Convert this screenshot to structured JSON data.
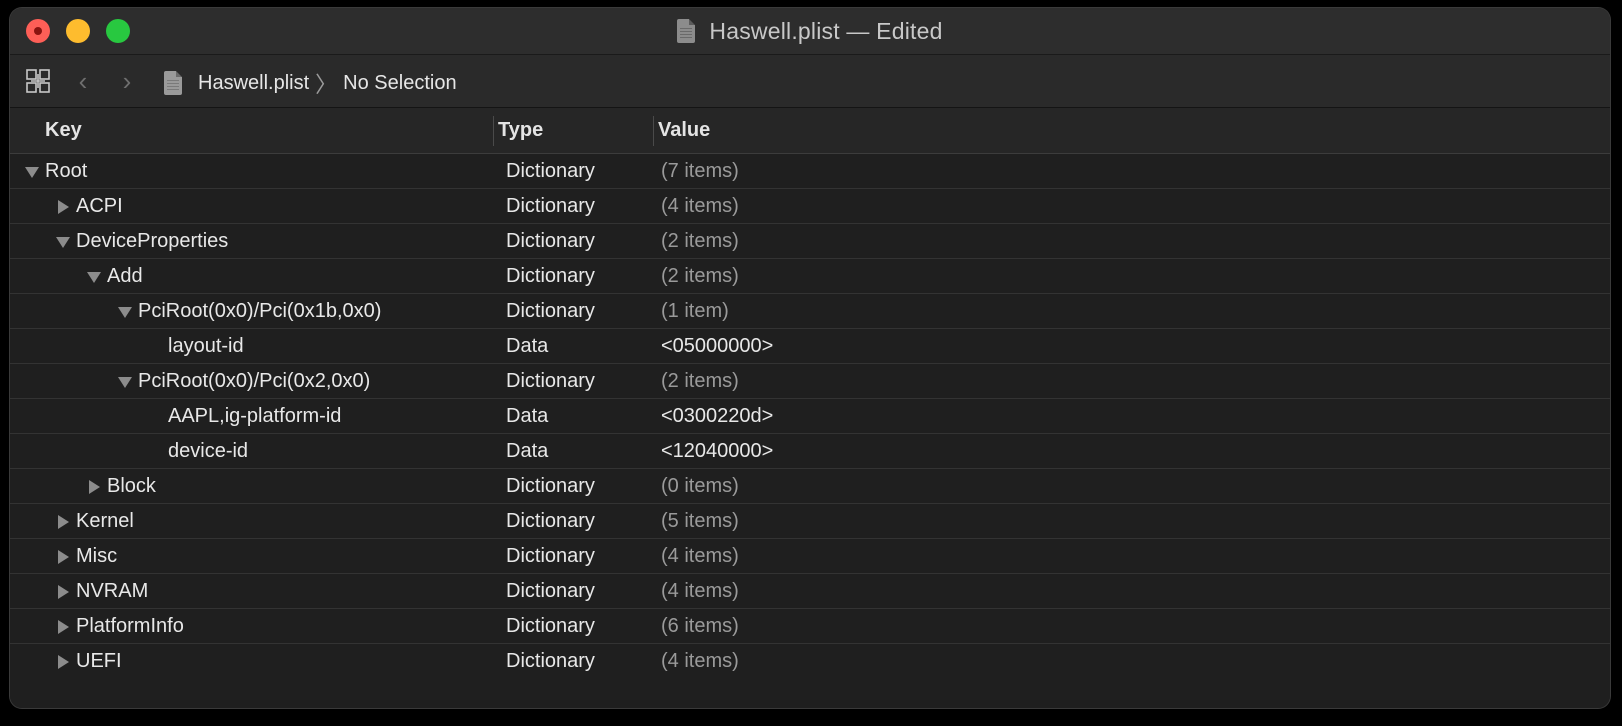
{
  "window": {
    "title": "Haswell.plist — Edited",
    "icon": "document-icon"
  },
  "toolbar": {
    "grid_icon": "grid-icon",
    "back_icon": "chevron-left-icon",
    "forward_icon": "chevron-right-icon",
    "back_glyph": "‹",
    "forward_glyph": "›",
    "breadcrumb": {
      "file": "Haswell.plist",
      "separator": "〉",
      "selection": "No Selection"
    }
  },
  "columns": {
    "key": "Key",
    "type": "Type",
    "value": "Value"
  },
  "rows": [
    {
      "key": "Root",
      "type": "Dictionary",
      "value": "(7 items)",
      "depth": 0,
      "disclosure": "open",
      "muted": true
    },
    {
      "key": "ACPI",
      "type": "Dictionary",
      "value": "(4 items)",
      "depth": 1,
      "disclosure": "closed",
      "muted": true
    },
    {
      "key": "DeviceProperties",
      "type": "Dictionary",
      "value": "(2 items)",
      "depth": 1,
      "disclosure": "open",
      "muted": true
    },
    {
      "key": "Add",
      "type": "Dictionary",
      "value": "(2 items)",
      "depth": 2,
      "disclosure": "open",
      "muted": true
    },
    {
      "key": "PciRoot(0x0)/Pci(0x1b,0x0)",
      "type": "Dictionary",
      "value": "(1 item)",
      "depth": 3,
      "disclosure": "open",
      "muted": true
    },
    {
      "key": "layout-id",
      "type": "Data",
      "value": "<05000000>",
      "depth": 4,
      "disclosure": "none",
      "muted": false
    },
    {
      "key": "PciRoot(0x0)/Pci(0x2,0x0)",
      "type": "Dictionary",
      "value": "(2 items)",
      "depth": 3,
      "disclosure": "open",
      "muted": true
    },
    {
      "key": "AAPL,ig-platform-id",
      "type": "Data",
      "value": "<0300220d>",
      "depth": 4,
      "disclosure": "none",
      "muted": false
    },
    {
      "key": "device-id",
      "type": "Data",
      "value": "<12040000>",
      "depth": 4,
      "disclosure": "none",
      "muted": false
    },
    {
      "key": "Block",
      "type": "Dictionary",
      "value": "(0 items)",
      "depth": 2,
      "disclosure": "closed",
      "muted": true
    },
    {
      "key": "Kernel",
      "type": "Dictionary",
      "value": "(5 items)",
      "depth": 1,
      "disclosure": "closed",
      "muted": true
    },
    {
      "key": "Misc",
      "type": "Dictionary",
      "value": "(4 items)",
      "depth": 1,
      "disclosure": "closed",
      "muted": true
    },
    {
      "key": "NVRAM",
      "type": "Dictionary",
      "value": "(4 items)",
      "depth": 1,
      "disclosure": "closed",
      "muted": true
    },
    {
      "key": "PlatformInfo",
      "type": "Dictionary",
      "value": "(6 items)",
      "depth": 1,
      "disclosure": "closed",
      "muted": true
    },
    {
      "key": "UEFI",
      "type": "Dictionary",
      "value": "(4 items)",
      "depth": 1,
      "disclosure": "closed",
      "muted": true
    }
  ],
  "colors": {
    "close": "#fe5f57",
    "minimize": "#febc2e",
    "maximize": "#28c840",
    "background": "#1f1f1f",
    "text": "#e8e8e8",
    "muted_text": "#9a9a9a"
  }
}
